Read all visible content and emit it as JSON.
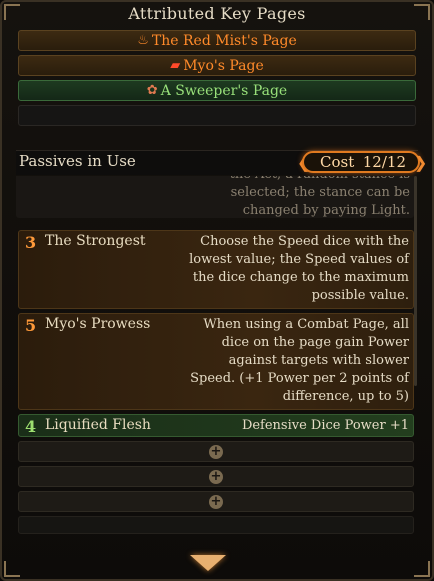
{
  "key_pages_section": {
    "title": "Attributed Key Pages",
    "pages": [
      {
        "name": "The Red Mist's Page",
        "style": "orange",
        "icon": "red-mist-icon"
      },
      {
        "name": "Myo's Page",
        "style": "orange",
        "icon": "myo-icon"
      },
      {
        "name": "A Sweeper's Page",
        "style": "green",
        "icon": "sweeper-icon"
      }
    ]
  },
  "passives_section": {
    "title": "Passives in Use",
    "cost_label": "Cost",
    "cost_value": "12/12",
    "partial_text": "the Act, a random stance is selected; the stance can be changed by paying Light.",
    "passives": [
      {
        "cost": "3",
        "name": "The Strongest",
        "description": "Choose the Speed dice with the lowest value; the Speed values of the dice change to the maximum possible value.",
        "style": "orange"
      },
      {
        "cost": "5",
        "name": "Myo's Prowess",
        "description": "When using a Combat Page, all dice on the page gain Power against targets with slower Speed. (+1 Power per 2 points of difference, up to 5)",
        "style": "orange"
      },
      {
        "cost": "4",
        "name": "Liquified Flesh",
        "description": "Defensive Dice Power +1",
        "style": "green"
      }
    ]
  },
  "colors": {
    "accent_orange": "#e07a20",
    "passive_green": "#9de070"
  }
}
